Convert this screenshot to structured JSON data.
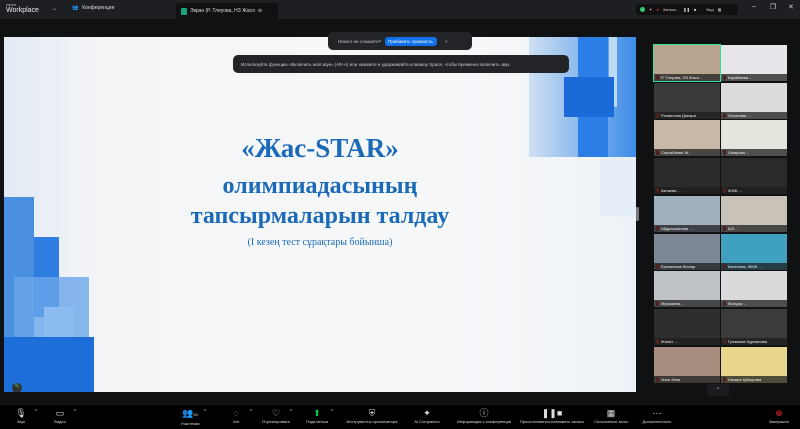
{
  "titlebar": {
    "logo_small": "zoom",
    "logo": "Workplace",
    "tab_meeting": "Конференция",
    "tab_share": "Экран (Р. Тлеуова, НЗ Жасо",
    "recording": "Запись...",
    "view": "Вид"
  },
  "banners": {
    "cant_hear": "Никого не слышите?",
    "volume_button": "Прибавить громкость.",
    "close": "×",
    "tip": "Используйте функцию «Включить мой звук» (Alt+A) или нажмите и удерживайте клавишу Space, чтобы временно включить звук."
  },
  "slide": {
    "title": "«Жас-STAR»",
    "line2": "олимпиадасының",
    "line3": "тапсырмаларын талдау",
    "subtitle": "(І кезең тест сұрақтары бойынша)"
  },
  "participants": [
    "Р. Тлеуова, НЗ Жасо...",
    "Карабаева ...",
    "Рахметова Динара",
    "Оспанова ...",
    "Серикбаева Ж...",
    "Омарова ...",
    "Акпаева ...",
    "ЖКЖ ...",
    "Абдрахманова ...",
    "ШЗ ...",
    "Ережепова Жанар",
    "Касенова, ЖКЖ ...",
    "Мукашева ...",
    "Жолдас ...",
    "Жанат ...",
    "Гуламова Курманова",
    "Зина Зина",
    "Назира Қайырова"
  ],
  "toolbar": [
    {
      "label": "Звук",
      "icon": "mic-muted-icon"
    },
    {
      "label": "Видео",
      "icon": "video-icon"
    },
    {
      "label": "Участники",
      "count": "50",
      "icon": "participants-icon"
    },
    {
      "label": "Чат",
      "icon": "chat-icon"
    },
    {
      "label": "Отреагировать",
      "icon": "heart-icon"
    },
    {
      "label": "Поделиться",
      "icon": "share-icon"
    },
    {
      "label": "Инструменты организатора",
      "icon": "shield-icon"
    },
    {
      "label": "AI Companion",
      "icon": "sparkle-icon"
    },
    {
      "label": "Информация о конференции",
      "icon": "info-icon"
    },
    {
      "label": "Приостановить/остановить запись",
      "icon": "pause-stop-icon"
    },
    {
      "label": "Сессионные залы",
      "icon": "breakout-icon"
    },
    {
      "label": "Дополнительно",
      "icon": "more-icon"
    },
    {
      "label": "Завершить",
      "icon": "end-icon"
    }
  ],
  "colors": {
    "accent": "#0e71eb",
    "slide_title": "#1b6ab8",
    "end": "#e02828",
    "active_speaker": "#2ee69a"
  }
}
